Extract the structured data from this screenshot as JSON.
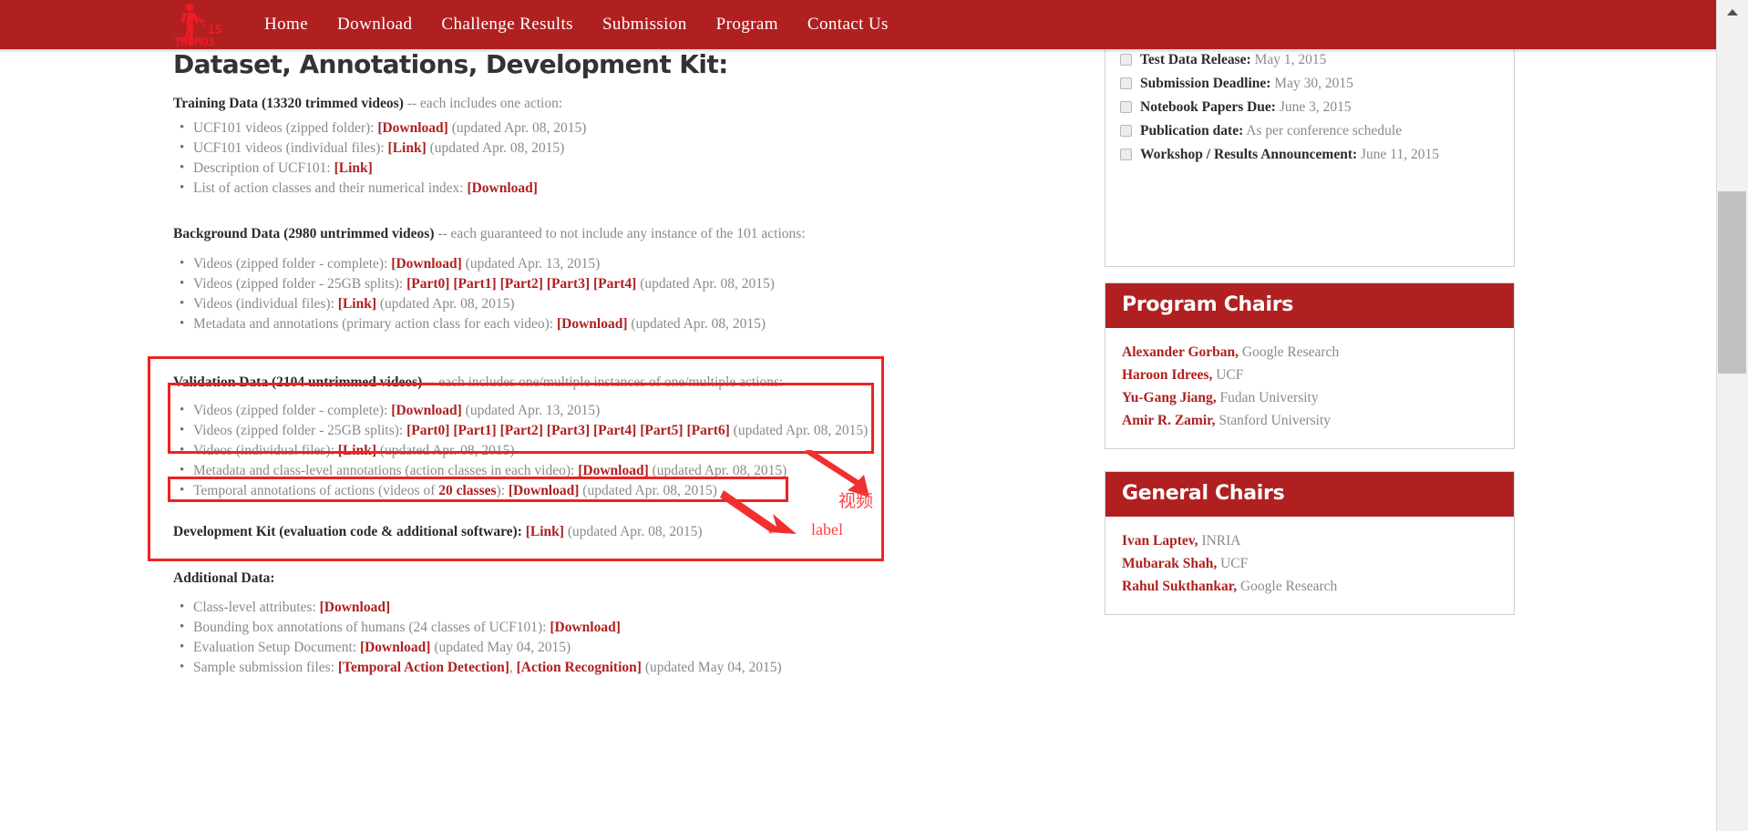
{
  "nav": {
    "logo": {
      "year": "'15",
      "name": "THUMOS",
      "icon": "running-figure-icon"
    },
    "links": [
      "Home",
      "Download",
      "Challenge Results",
      "Submission",
      "Program",
      "Contact Us"
    ]
  },
  "colors": {
    "brand_red": "#b02020",
    "annotation_red": "#ee2222",
    "annotation_text_red": "#ff4040",
    "body_text": "#8a8a8a",
    "heading_dark": "#2b2b2b"
  },
  "main": {
    "title": "Dataset, Annotations, Development Kit:",
    "training": {
      "heading_bold": "Training Data (13320 trimmed videos)",
      "heading_rest": " -- each includes one action:",
      "items": [
        {
          "pre": "UCF101 videos (zipped folder): ",
          "links": [
            "[Download]"
          ],
          "post": " (updated Apr. 08, 2015)"
        },
        {
          "pre": "UCF101 videos (individual files): ",
          "links": [
            "[Link]"
          ],
          "post": " (updated Apr. 08, 2015)"
        },
        {
          "pre": "Description of UCF101: ",
          "links": [
            "[Link]"
          ],
          "post": ""
        },
        {
          "pre": "List of action classes and their numerical index: ",
          "links": [
            "[Download]"
          ],
          "post": ""
        }
      ]
    },
    "background": {
      "heading_bold": "Background Data (2980 untrimmed videos)",
      "heading_rest": " -- each guaranteed to not include any instance of the 101 actions:",
      "items": [
        {
          "pre": "Videos (zipped folder - complete): ",
          "links": [
            "[Download]"
          ],
          "post": " (updated Apr. 13, 2015)"
        },
        {
          "pre": "Videos (zipped folder - 25GB splits): ",
          "links": [
            "[Part0]",
            "[Part1]",
            "[Part2]",
            "[Part3]",
            "[Part4]"
          ],
          "post": " (updated Apr. 08, 2015)"
        },
        {
          "pre": "Videos (individual files): ",
          "links": [
            "[Link]"
          ],
          "post": " (updated Apr. 08, 2015)"
        },
        {
          "pre": "Metadata and annotations (primary action class for each video): ",
          "links": [
            "[Download]"
          ],
          "post": " (updated Apr. 08, 2015)"
        }
      ]
    },
    "validation": {
      "heading_bold": "Validation Data (2104 untrimmed videos)",
      "heading_rest": " -- each includes one/multiple instances of one/multiple actions:",
      "items": [
        {
          "pre": "Videos (zipped folder - complete): ",
          "links": [
            "[Download]"
          ],
          "post": " (updated Apr. 13, 2015)"
        },
        {
          "pre": "Videos (zipped folder - 25GB splits): ",
          "links": [
            "[Part0]",
            "[Part1]",
            "[Part2]",
            "[Part3]",
            "[Part4]",
            "[Part5]",
            "[Part6]"
          ],
          "post": " (updated Apr. 08, 2015)"
        },
        {
          "pre": "Videos (individual files): ",
          "links": [
            "[Link]"
          ],
          "post": " (updated Apr. 08, 2015)"
        },
        {
          "pre": "Metadata and class-level annotations (action classes in each video): ",
          "links": [
            "[Download]"
          ],
          "post": " (updated Apr. 08, 2015)"
        },
        {
          "pre": "Temporal annotations of actions (videos of ",
          "highlight": "20 classes",
          "pre2": "): ",
          "links": [
            "[Download]"
          ],
          "post": " (updated Apr. 08, 2015)"
        }
      ],
      "devkit_bold": "Development Kit (evaluation code & additional software): ",
      "devkit_link": "[Link]",
      "devkit_post": " (updated Apr. 08, 2015)"
    },
    "additional": {
      "heading": "Additional Data:",
      "items": [
        {
          "pre": "Class-level attributes: ",
          "links": [
            "[Download]"
          ],
          "post": ""
        },
        {
          "pre": "Bounding box annotations of humans (24 classes of UCF101): ",
          "links": [
            "[Download]"
          ],
          "post": ""
        },
        {
          "pre": "Evaluation Setup Document: ",
          "links": [
            "[Download]"
          ],
          "post": " (updated May 04, 2015)"
        },
        {
          "pre": "Sample submission files: ",
          "links": [
            "[Temporal Action Detection]",
            "[Action Recognition]"
          ],
          "separator": ", ",
          "post": " (updated May 04, 2015)"
        }
      ]
    }
  },
  "annotations": {
    "video_label": "视频",
    "label_label": "label"
  },
  "sidebar": {
    "deadlines": [
      {
        "name": "Test Data Release:",
        "value": " May 1, 2015"
      },
      {
        "name": "Submission Deadline:",
        "value": " May 30, 2015"
      },
      {
        "name": "Notebook Papers Due:",
        "value": " June 3, 2015"
      },
      {
        "name": "Publication date:",
        "value": " As per conference schedule"
      },
      {
        "name": "Workshop / Results Announcement:",
        "value": " June 11, 2015"
      }
    ],
    "program_chairs": {
      "title": "Program Chairs",
      "people": [
        {
          "name": "Alexander Gorban,",
          "affil": " Google Research"
        },
        {
          "name": "Haroon Idrees,",
          "affil": " UCF"
        },
        {
          "name": "Yu-Gang Jiang,",
          "affil": " Fudan University"
        },
        {
          "name": "Amir R. Zamir,",
          "affil": " Stanford University"
        }
      ]
    },
    "general_chairs": {
      "title": "General Chairs",
      "people": [
        {
          "name": "Ivan Laptev,",
          "affil": " INRIA"
        },
        {
          "name": "Mubarak Shah,",
          "affil": " UCF"
        },
        {
          "name": "Rahul Sukthankar,",
          "affil": " Google Research"
        }
      ]
    }
  }
}
